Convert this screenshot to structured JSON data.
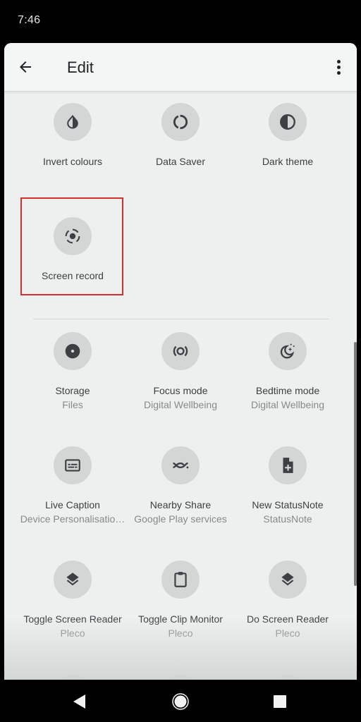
{
  "status_bar": {
    "time": "7:46"
  },
  "header": {
    "title": "Edit"
  },
  "tiles_active": [
    {
      "label": "Invert colours",
      "icon": "invert-colors-icon"
    },
    {
      "label": "Data Saver",
      "icon": "data-saver-icon"
    },
    {
      "label": "Dark theme",
      "icon": "dark-theme-icon"
    },
    {
      "label": "Screen record",
      "icon": "screen-record-icon",
      "highlighted": true
    }
  ],
  "tiles_available": [
    {
      "label": "Storage",
      "sublabel": "Files",
      "icon": "storage-icon"
    },
    {
      "label": "Focus mode",
      "sublabel": "Digital Wellbeing",
      "icon": "focus-mode-icon"
    },
    {
      "label": "Bedtime mode",
      "sublabel": "Digital Wellbeing",
      "icon": "bedtime-icon"
    },
    {
      "label": "Live Caption",
      "sublabel": "Device Personalisatio…",
      "icon": "live-caption-icon"
    },
    {
      "label": "Nearby Share",
      "sublabel": "Google Play services",
      "icon": "nearby-share-icon"
    },
    {
      "label": "New StatusNote",
      "sublabel": "StatusNote",
      "icon": "new-note-icon"
    },
    {
      "label": "Toggle Screen Reader",
      "sublabel": "Pleco",
      "icon": "layers-icon"
    },
    {
      "label": "Toggle Clip Monitor",
      "sublabel": "Pleco",
      "icon": "clipboard-icon"
    },
    {
      "label": "Do Screen Reader",
      "sublabel": "Pleco",
      "icon": "layers-icon"
    }
  ],
  "colors": {
    "highlight": "#d32f2f",
    "tile_bg": "#d4d6d5",
    "icon": "#3c4043"
  },
  "nav": {
    "back": "back-icon",
    "home": "home-icon",
    "recents": "recents-icon"
  }
}
